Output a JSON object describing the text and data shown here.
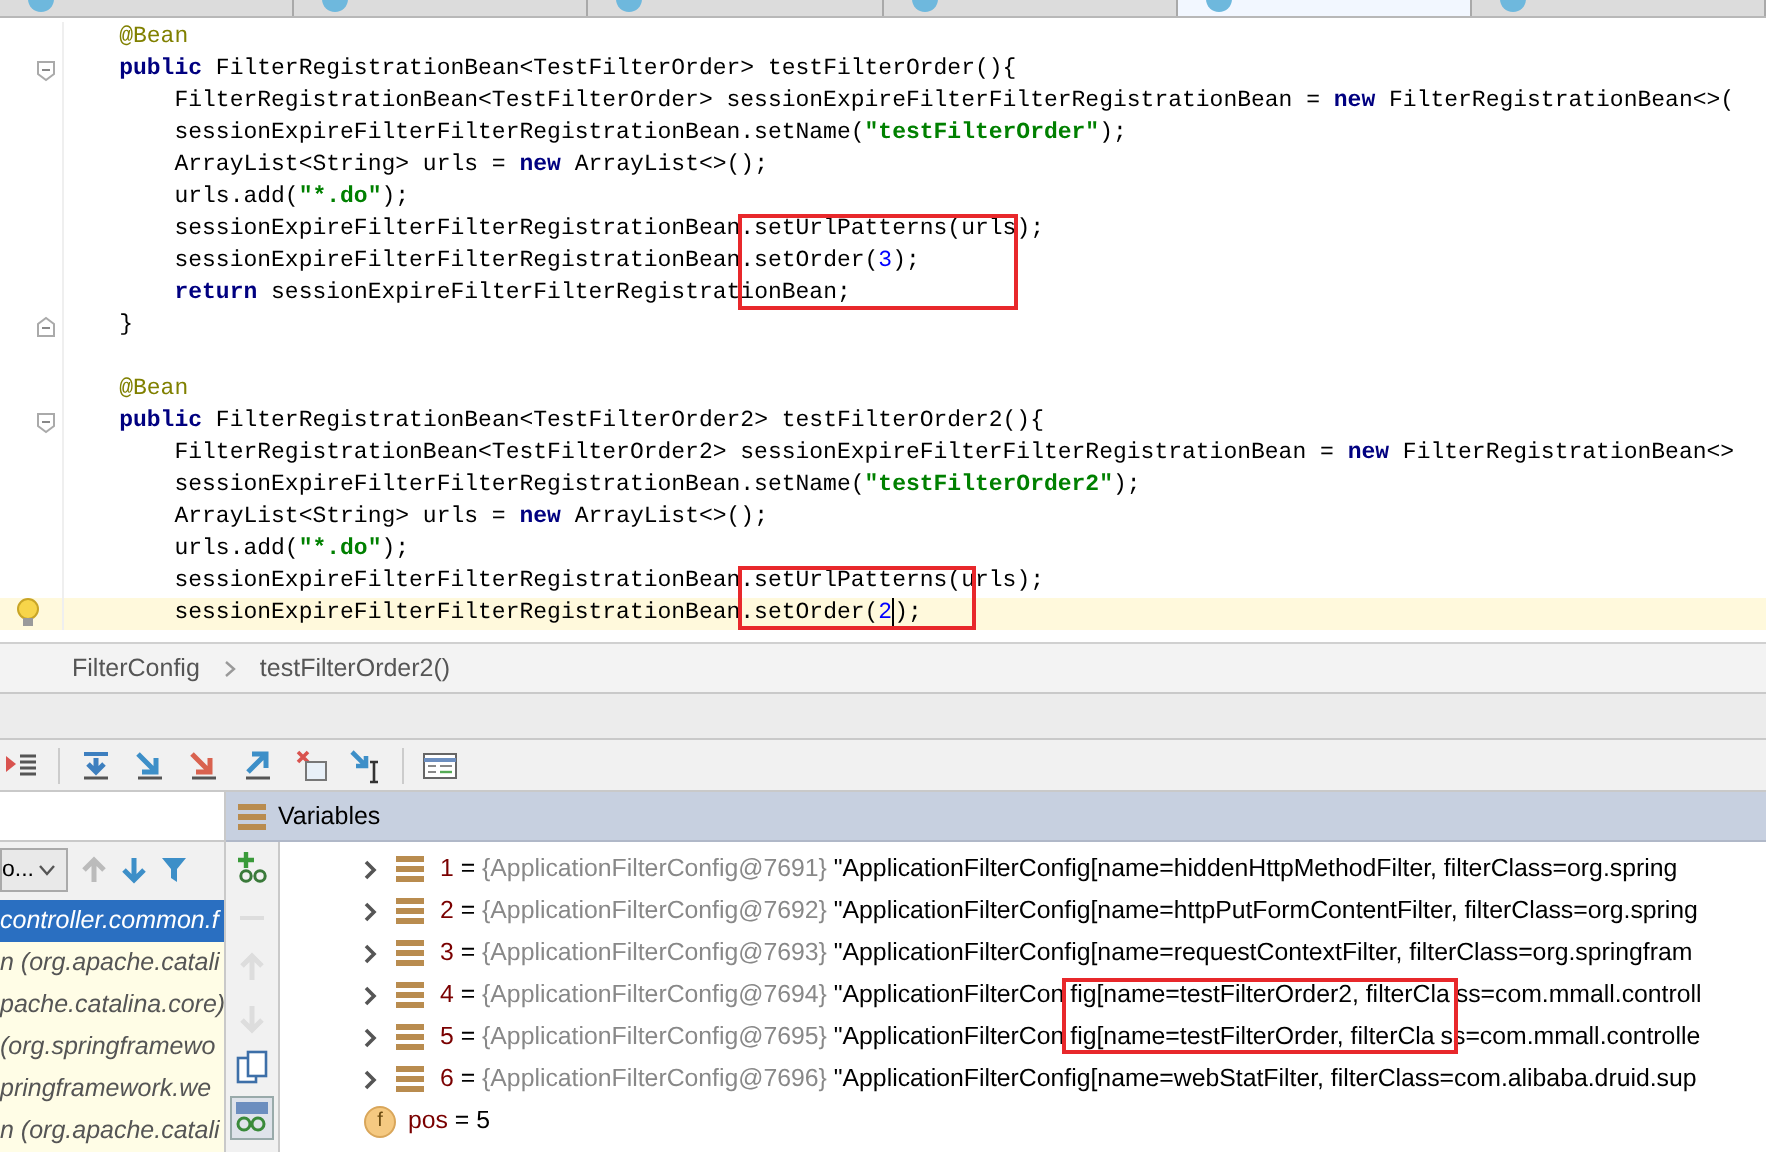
{
  "editor_tabs": [
    {
      "selected": false
    },
    {
      "selected": false
    },
    {
      "selected": false
    },
    {
      "selected": false
    },
    {
      "selected": true
    },
    {
      "selected": false
    }
  ],
  "code_lines": [
    {
      "kind": "plain",
      "segments": [
        {
          "kind": "annotation",
          "text": "    @Bean"
        }
      ]
    },
    {
      "kind": "fold-start",
      "segments": [
        {
          "kind": "keyword",
          "text": "    public "
        },
        {
          "kind": "plain",
          "text": "FilterRegistrationBean<TestFilterOrder> testFilterOrder(){"
        }
      ]
    },
    {
      "kind": "plain",
      "segments": [
        {
          "kind": "plain",
          "text": "        FilterRegistrationBean<TestFilterOrder> sessionExpireFilterFilterRegistrationBean = "
        },
        {
          "kind": "keyword",
          "text": "new "
        },
        {
          "kind": "plain",
          "text": "FilterRegistrationBean<>("
        }
      ]
    },
    {
      "kind": "plain",
      "segments": [
        {
          "kind": "plain",
          "text": "        sessionExpireFilterFilterRegistrationBean.setName("
        },
        {
          "kind": "string",
          "text": "\"testFilterOrder\""
        },
        {
          "kind": "plain",
          "text": ");"
        }
      ]
    },
    {
      "kind": "plain",
      "segments": [
        {
          "kind": "plain",
          "text": "        ArrayList<String> urls = "
        },
        {
          "kind": "keyword",
          "text": "new "
        },
        {
          "kind": "plain",
          "text": "ArrayList<>();"
        }
      ]
    },
    {
      "kind": "plain",
      "segments": [
        {
          "kind": "plain",
          "text": "        urls.add("
        },
        {
          "kind": "string",
          "text": "\"*.do\""
        },
        {
          "kind": "plain",
          "text": ");"
        }
      ]
    },
    {
      "kind": "plain",
      "segments": [
        {
          "kind": "plain",
          "text": "        sessionExpireFilterFilterRegistrationBean"
        },
        {
          "kind": "plain",
          "text": ".setUrlPatterns(urls",
          "boxed": true
        },
        {
          "kind": "plain",
          "text": ");"
        }
      ]
    },
    {
      "kind": "plain",
      "segments": [
        {
          "kind": "plain",
          "text": "        sessionExpireFilterFilterRegistrationBean"
        },
        {
          "kind": "plain",
          "text": ".setOrder(",
          "boxed": true
        },
        {
          "kind": "number",
          "text": "3",
          "boxed": true
        },
        {
          "kind": "plain",
          "text": ");",
          "boxed": true
        }
      ]
    },
    {
      "kind": "plain",
      "segments": [
        {
          "kind": "keyword",
          "text": "        return "
        },
        {
          "kind": "plain",
          "text": "sessionExpireFilterFilterRegistrat"
        },
        {
          "kind": "plain",
          "text": "ionBean;",
          "boxed": true
        }
      ]
    },
    {
      "kind": "fold-end",
      "segments": [
        {
          "kind": "plain",
          "text": "    }"
        }
      ]
    },
    {
      "kind": "plain"
    },
    {
      "kind": "plain",
      "segments": [
        {
          "kind": "annotation",
          "text": "    @Bean"
        }
      ]
    },
    {
      "kind": "fold-start",
      "segments": [
        {
          "kind": "keyword",
          "text": "    public "
        },
        {
          "kind": "plain",
          "text": "FilterRegistrationBean<TestFilterOrder2> testFilterOrder2(){"
        }
      ]
    },
    {
      "kind": "plain",
      "segments": [
        {
          "kind": "plain",
          "text": "        FilterRegistrationBean<TestFilterOrder2> sessionExpireFilterFilterRegistrationBean = "
        },
        {
          "kind": "keyword",
          "text": "new "
        },
        {
          "kind": "plain",
          "text": "FilterRegistrationBean<>"
        }
      ]
    },
    {
      "kind": "plain",
      "segments": [
        {
          "kind": "plain",
          "text": "        sessionExpireFilterFilterRegistrationBean.setName("
        },
        {
          "kind": "string",
          "text": "\"testFilterOrder2\""
        },
        {
          "kind": "plain",
          "text": ");"
        }
      ]
    },
    {
      "kind": "plain",
      "segments": [
        {
          "kind": "plain",
          "text": "        ArrayList<String> urls = "
        },
        {
          "kind": "keyword",
          "text": "new "
        },
        {
          "kind": "plain",
          "text": "ArrayList<>();"
        }
      ]
    },
    {
      "kind": "plain",
      "segments": [
        {
          "kind": "plain",
          "text": "        urls.add("
        },
        {
          "kind": "string",
          "text": "\"*.do\""
        },
        {
          "kind": "plain",
          "text": ");"
        }
      ]
    },
    {
      "kind": "plain",
      "segments": [
        {
          "kind": "plain",
          "text": "        sessionExpireFilterFilterRegistrationBean"
        },
        {
          "kind": "plain",
          "text": ".setUrlPatterns(u",
          "boxed": true
        },
        {
          "kind": "plain",
          "text": "rls);"
        }
      ]
    },
    {
      "kind": "current",
      "segments": [
        {
          "kind": "plain",
          "text": "        sessionExpireFilterFilterRegistrationBean"
        },
        {
          "kind": "plain",
          "text": ".setOrder(",
          "boxed": true
        },
        {
          "kind": "number",
          "text": "2",
          "boxed": true,
          "caret": true
        },
        {
          "kind": "plain",
          "text": ");"
        }
      ]
    }
  ],
  "breadcrumbs": [
    {
      "text": "FilterConfig"
    },
    {
      "text": "testFilterOrder2()"
    }
  ],
  "frames_panel": {
    "dropdown": "o...",
    "frames": [
      {
        "text": "controller.common.f",
        "selected": true
      },
      {
        "text": "n (org.apache.catali",
        "selected": false
      },
      {
        "text": "pache.catalina.core)",
        "selected": false
      },
      {
        "text": "(org.springframewo",
        "selected": false
      },
      {
        "text": "pringframework.we",
        "selected": false
      },
      {
        "text": "n (org.apache.catali",
        "selected": false
      }
    ]
  },
  "watch_toolbar": [
    {
      "disabled": false,
      "selected": false
    },
    {
      "disabled": true,
      "selected": false
    },
    {
      "disabled": true,
      "selected": false
    },
    {
      "disabled": true,
      "selected": false
    },
    {
      "disabled": false,
      "selected": false
    },
    {
      "disabled": false,
      "selected": true
    }
  ],
  "variables_panel": {
    "title": "Variables",
    "rows": [
      {
        "expanded": false,
        "segments": [
          {
            "kind": "name",
            "text": "1"
          },
          {
            "kind": "plain",
            "text": " = "
          },
          {
            "kind": "ref",
            "text": "{ApplicationFilterConfig@7691} "
          },
          {
            "kind": "plain",
            "text": "\"ApplicationFilterConfig[name=hiddenHttpMethodFilter, filterClass=org.spring"
          }
        ]
      },
      {
        "expanded": false,
        "segments": [
          {
            "kind": "name",
            "text": "2"
          },
          {
            "kind": "plain",
            "text": " = "
          },
          {
            "kind": "ref",
            "text": "{ApplicationFilterConfig@7692} "
          },
          {
            "kind": "plain",
            "text": "\"ApplicationFilterConfig[name=httpPutFormContentFilter, filterClass=org.spring"
          }
        ]
      },
      {
        "expanded": false,
        "segments": [
          {
            "kind": "name",
            "text": "3"
          },
          {
            "kind": "plain",
            "text": " = "
          },
          {
            "kind": "ref",
            "text": "{ApplicationFilterConfig@7693} "
          },
          {
            "kind": "plain",
            "text": "\"ApplicationFilterConfig[name=requestContextFilter, filterClass=org.springfram"
          }
        ]
      },
      {
        "expanded": false,
        "segments": [
          {
            "kind": "name",
            "text": "4"
          },
          {
            "kind": "plain",
            "text": " = "
          },
          {
            "kind": "ref",
            "text": "{ApplicationFilterConfig@7694} "
          },
          {
            "kind": "plain",
            "text": "\"ApplicationFilterCon"
          },
          {
            "kind": "plain",
            "text": "fig[name=testFilterOrder2, filterCla",
            "boxed": true
          },
          {
            "kind": "plain",
            "text": "ss=com.mmall.controll"
          }
        ]
      },
      {
        "expanded": false,
        "segments": [
          {
            "kind": "name",
            "text": "5"
          },
          {
            "kind": "plain",
            "text": " = "
          },
          {
            "kind": "ref",
            "text": "{ApplicationFilterConfig@7695} "
          },
          {
            "kind": "plain",
            "text": "\"ApplicationFilterCon"
          },
          {
            "kind": "plain",
            "text": "fig[name=testFilterOrder, filterCla",
            "boxed": true
          },
          {
            "kind": "plain",
            "text": "ss=com.mmall.controlle"
          }
        ]
      },
      {
        "expanded": false,
        "segments": [
          {
            "kind": "name",
            "text": "6"
          },
          {
            "kind": "plain",
            "text": " = "
          },
          {
            "kind": "ref",
            "text": "{ApplicationFilterConfig@7696} "
          },
          {
            "kind": "plain",
            "text": "\"ApplicationFilterConfig[name=webStatFilter, filterClass=com.alibaba.druid.sup"
          }
        ]
      }
    ],
    "field": {
      "badge": "f",
      "segments": [
        {
          "kind": "name",
          "text": "pos"
        },
        {
          "kind": "plain",
          "text": " = 5"
        }
      ]
    }
  }
}
